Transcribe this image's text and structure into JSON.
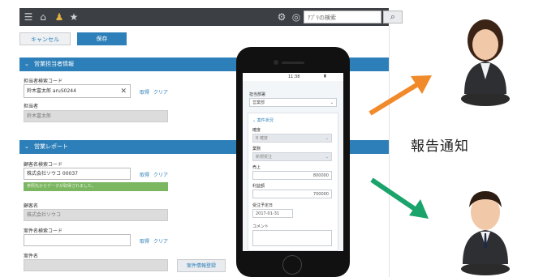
{
  "toolbar": {
    "search_placeholder": "ｱﾌﾟﾘの検索",
    "search_icon": "search-icon"
  },
  "actions": {
    "cancel": "キャンセル",
    "save": "保存"
  },
  "section1": {
    "title": "営業担当者情報",
    "rep_code_label": "担当者検索コード",
    "rep_code_value": "鈴木富太郎 aruS0244",
    "lookup": "取得",
    "clear": "クリア",
    "rep_name_label": "担当者",
    "rep_name_value": "鈴木富太郎"
  },
  "section2": {
    "title": "営業レポート",
    "client_code_label": "顧客名検索コード",
    "client_code_value": "株式会社ソウコ 00037",
    "lookup": "取得",
    "clear": "クリア",
    "success_msg": "参照先からデータが取得されました。",
    "client_name_label": "顧客名",
    "client_name_value": "株式会社ソウコ",
    "case_code_label": "案件名検索コード",
    "case_lookup": "取得",
    "case_clear": "クリア",
    "case_name_label": "案件名",
    "register_button": "案件情報登録"
  },
  "phone": {
    "status_time": "11:38",
    "field_label": "担当部署",
    "field_value": "営業部",
    "section": "案件状況",
    "status_label": "確度",
    "status_value": "B 確度",
    "type_label": "業務",
    "type_value": "新規受注",
    "sales_label": "売上",
    "sales_value": "800000",
    "profit_label": "利益額",
    "profit_value": "700000",
    "date_label": "受注予定日",
    "date_value": "2017-01-31",
    "comment_label": "コメント"
  },
  "right": {
    "notification": "報告通知"
  }
}
